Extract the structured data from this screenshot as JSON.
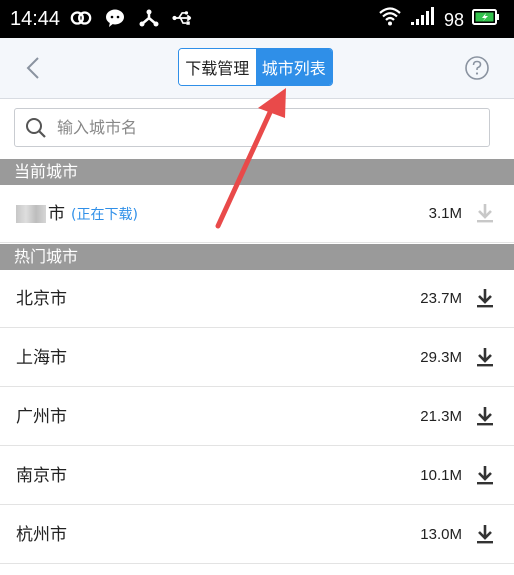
{
  "statusbar": {
    "time": "14:44",
    "battery": "98"
  },
  "navbar": {
    "tab_download": "下载管理",
    "tab_citylist": "城市列表",
    "active_tab": "城市列表"
  },
  "search": {
    "placeholder": "输入城市名"
  },
  "sections": {
    "current": "当前城市",
    "hot": "热门城市"
  },
  "current_city": {
    "name_suffix": "市",
    "status": "(正在下载)",
    "size": "3.1M"
  },
  "hot_cities": [
    {
      "name": "北京市",
      "size": "23.7M"
    },
    {
      "name": "上海市",
      "size": "29.3M"
    },
    {
      "name": "广州市",
      "size": "21.3M"
    },
    {
      "name": "南京市",
      "size": "10.1M"
    },
    {
      "name": "杭州市",
      "size": "13.0M"
    }
  ],
  "colors": {
    "accent": "#2f8fe8",
    "annotation_arrow": "#e94a4a",
    "section_bg": "#9a9a9a"
  }
}
